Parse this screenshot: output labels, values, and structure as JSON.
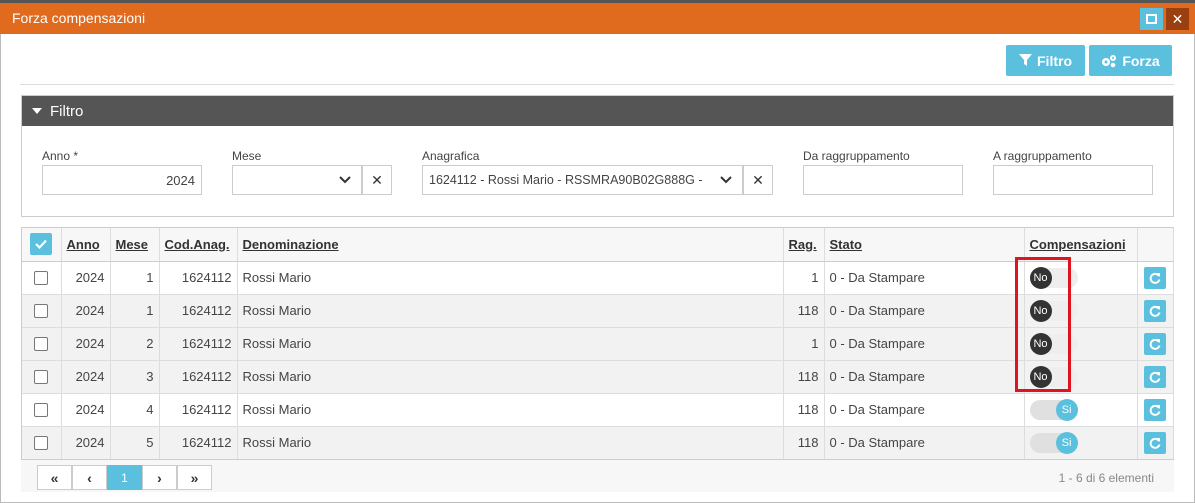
{
  "window": {
    "title": "Forza compensazioni"
  },
  "toolbar": {
    "filtro_label": "Filtro",
    "forza_label": "Forza"
  },
  "filter": {
    "header": "Filtro",
    "anno_label": "Anno *",
    "anno_value": "2024",
    "mese_label": "Mese",
    "mese_value": "",
    "anagrafica_label": "Anagrafica",
    "anagrafica_value": "1624112 - Rossi Mario - RSSMRA90B02G888G -",
    "da_label": "Da raggruppamento",
    "da_value": "",
    "a_label": "A raggruppamento",
    "a_value": ""
  },
  "grid": {
    "columns": {
      "anno": "Anno",
      "mese": "Mese",
      "cod": "Cod.Anag.",
      "den": "Denominazione",
      "rag": "Rag.",
      "stato": "Stato",
      "comp": "Compensazioni"
    },
    "rows": [
      {
        "anno": "2024",
        "mese": "1",
        "cod": "1624112",
        "den": "Rossi Mario",
        "rag": "1",
        "stato": "0 - Da Stampare",
        "comp": "No"
      },
      {
        "anno": "2024",
        "mese": "1",
        "cod": "1624112",
        "den": "Rossi Mario",
        "rag": "118",
        "stato": "0 - Da Stampare",
        "comp": "No"
      },
      {
        "anno": "2024",
        "mese": "2",
        "cod": "1624112",
        "den": "Rossi Mario",
        "rag": "1",
        "stato": "0 - Da Stampare",
        "comp": "No"
      },
      {
        "anno": "2024",
        "mese": "3",
        "cod": "1624112",
        "den": "Rossi Mario",
        "rag": "118",
        "stato": "0 - Da Stampare",
        "comp": "No"
      },
      {
        "anno": "2024",
        "mese": "4",
        "cod": "1624112",
        "den": "Rossi Mario",
        "rag": "118",
        "stato": "0 - Da Stampare",
        "comp": "Si"
      },
      {
        "anno": "2024",
        "mese": "5",
        "cod": "1624112",
        "den": "Rossi Mario",
        "rag": "118",
        "stato": "0 - Da Stampare",
        "comp": "Si"
      }
    ]
  },
  "pager": {
    "first": "«",
    "prev": "‹",
    "page": "1",
    "next": "›",
    "last": "»",
    "info": "1 - 6 di 6 elementi"
  },
  "colors": {
    "accent": "#5bc0de",
    "titlebar": "#e06a1d",
    "highlight": "#e0141e",
    "filter_header": "#555555"
  }
}
